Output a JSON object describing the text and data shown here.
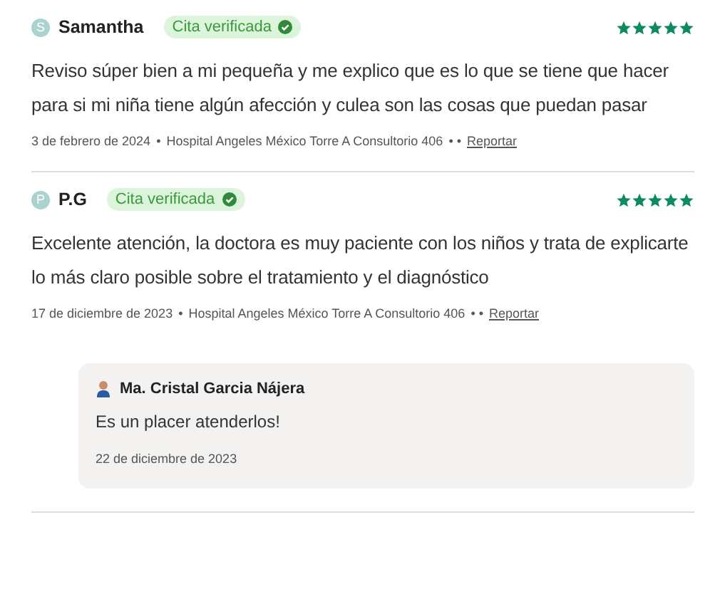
{
  "reviews": [
    {
      "initial": "S",
      "author": "Samantha",
      "badge": "Cita verificada",
      "stars": 5,
      "text": "Reviso súper bien a mi pequeña y me explico que es lo que se tiene que hacer para si mi niña tiene algún afección y culea son las cosas que puedan pasar",
      "date": "3 de febrero de 2024",
      "bullet": "•",
      "place": "Hospital Angeles México Torre A Consultorio 406",
      "separator": "• •",
      "report": "Reportar"
    },
    {
      "initial": "P",
      "author": "P.G",
      "badge": "Cita verificada",
      "stars": 5,
      "text": "Excelente atención, la doctora es muy paciente con los niños y trata de explicarte lo más claro posible sobre el tratamiento y el diagnóstico",
      "date": "17 de diciembre de 2023",
      "bullet": "•",
      "place": "Hospital Angeles México Torre A Consultorio 406",
      "separator": "• •",
      "report": "Reportar",
      "reply": {
        "author": "Ma. Cristal Garcia Nájera",
        "text": "Es un placer atenderlos!",
        "date": "22 de diciembre de 2023"
      }
    }
  ]
}
